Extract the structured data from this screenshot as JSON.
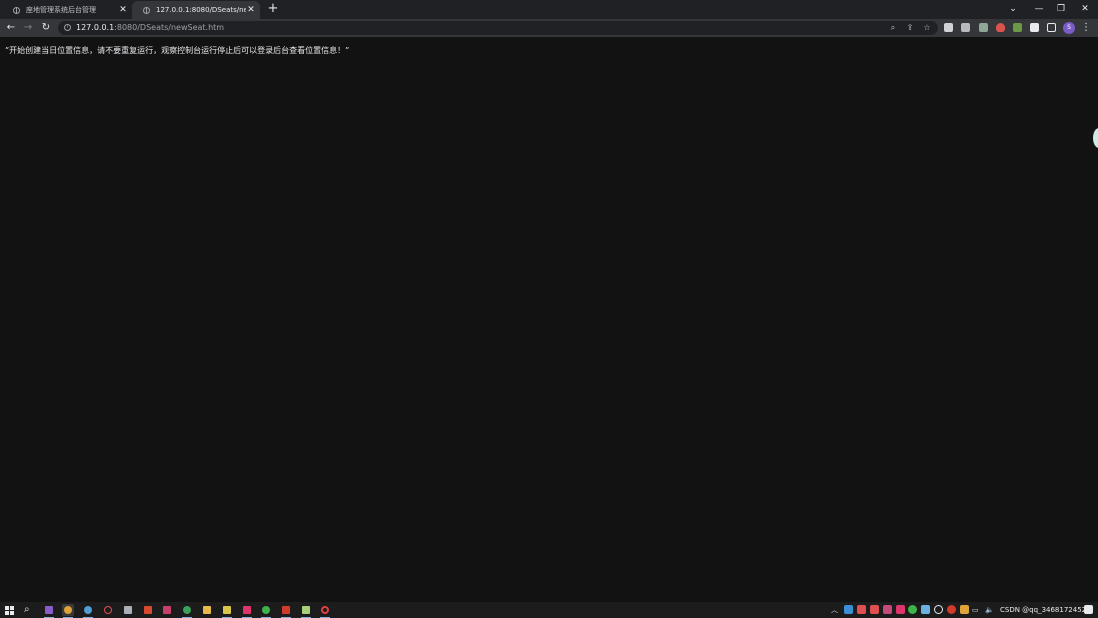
{
  "browser": {
    "tabs": [
      {
        "title": "座地管理系统后台管理",
        "active": false,
        "close_icon": "close-icon"
      },
      {
        "title": "127.0.0.1:8080/DSeats/newSeat.htm",
        "active": true,
        "close_icon": "close-icon"
      }
    ],
    "new_tab_icon": "plus-icon",
    "window_controls": {
      "minimize": "minimize-icon",
      "restore": "restore-icon",
      "close": "close-icon"
    },
    "address": {
      "host": "127.0.0.1",
      "rest": ":8080/DSeats/newSeat.htm"
    },
    "profile_initial": "S",
    "accent_color": "#7a5cc7"
  },
  "page": {
    "message": "”开始创建当日位置信息，请不要重复运行，观察控制台运行停止后可以登录后台查看位置信息！”",
    "background": "#121212"
  },
  "taskbar": {
    "tray_text": "CSDN @qq_34681724521"
  }
}
